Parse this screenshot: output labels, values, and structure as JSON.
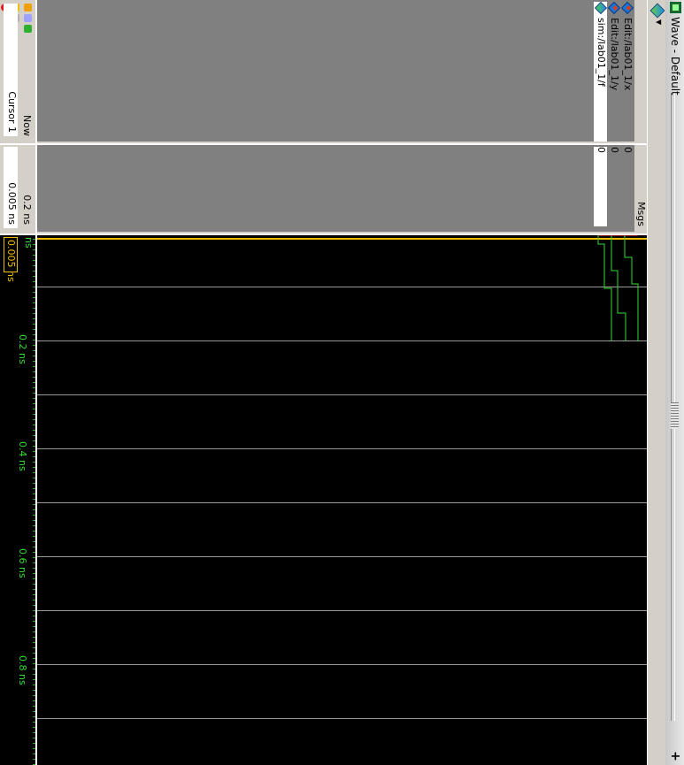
{
  "window": {
    "title": "Wave - Default"
  },
  "signals": [
    {
      "name": "Edit:/lab01_1/x",
      "value": "0",
      "kind": "in"
    },
    {
      "name": "Edit:/lab01_1/y",
      "value": "0",
      "kind": "in"
    },
    {
      "name": "sim:/lab01_1/f",
      "value": "0",
      "kind": "out"
    }
  ],
  "messages_header": "Msgs",
  "cursors": {
    "now_label": "Now",
    "now_value": "0.2 ns",
    "cursor_label": "Cursor 1",
    "cursor_value": "0.005 ns",
    "cursor_marker": "0.005 ns"
  },
  "timeline": {
    "labels": [
      "ns",
      "0.2 ns",
      "0.4 ns",
      "0.6 ns",
      "0.8 ns"
    ]
  },
  "colors": {
    "wave": "#33dd33",
    "cursor": "#f0c000",
    "background": "#000000",
    "panel": "#808080"
  },
  "icons": [
    "wave-window-icon",
    "add-wave-icon",
    "lock-icon",
    "scissors-icon",
    "zoom-icon",
    "remove-icon",
    "plus-icon"
  ]
}
